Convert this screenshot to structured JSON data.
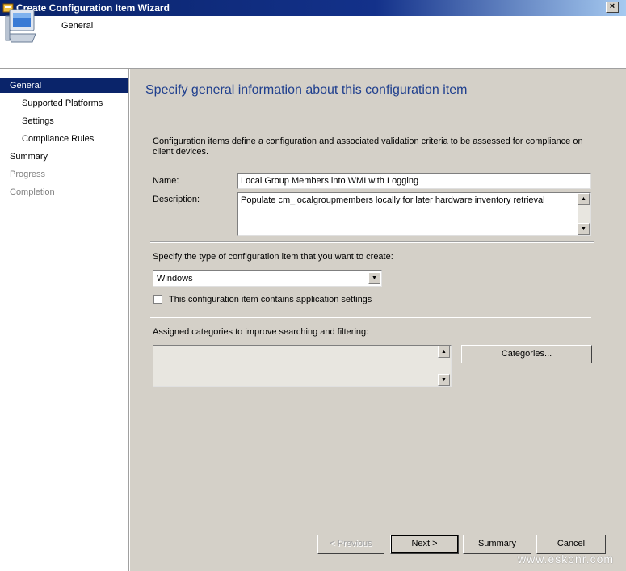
{
  "window": {
    "title": "Create Configuration Item Wizard",
    "close_glyph": "×"
  },
  "header": {
    "title": "General",
    "icon": "computer-icon"
  },
  "nav": {
    "items": [
      {
        "label": "General",
        "state": "active"
      },
      {
        "label": "Supported Platforms",
        "state": "normal"
      },
      {
        "label": "Settings",
        "state": "normal"
      },
      {
        "label": "Compliance Rules",
        "state": "normal"
      },
      {
        "label": "Summary",
        "state": "normal"
      },
      {
        "label": "Progress",
        "state": "disabled"
      },
      {
        "label": "Completion",
        "state": "disabled"
      }
    ]
  },
  "main": {
    "heading": "Specify general information about this configuration item",
    "intro": "Configuration items define a configuration and associated validation criteria to be assessed for compliance on client devices.",
    "name_label": "Name:",
    "name_value": "Local Group Members into WMI with Logging",
    "description_label": "Description:",
    "description_value": "Populate cm_localgroupmembers locally for later hardware inventory retrieval",
    "type_label": "Specify the type of configuration item that you want to create:",
    "type_value": "Windows",
    "app_settings_label": "This configuration item contains application settings",
    "app_settings_checked": false,
    "categories_label": "Assigned categories to improve searching and filtering:",
    "categories_button": "Categories..."
  },
  "footer": {
    "previous": "< Previous",
    "next": "Next >",
    "summary": "Summary",
    "cancel": "Cancel"
  },
  "watermark": "www.eskonr.com"
}
